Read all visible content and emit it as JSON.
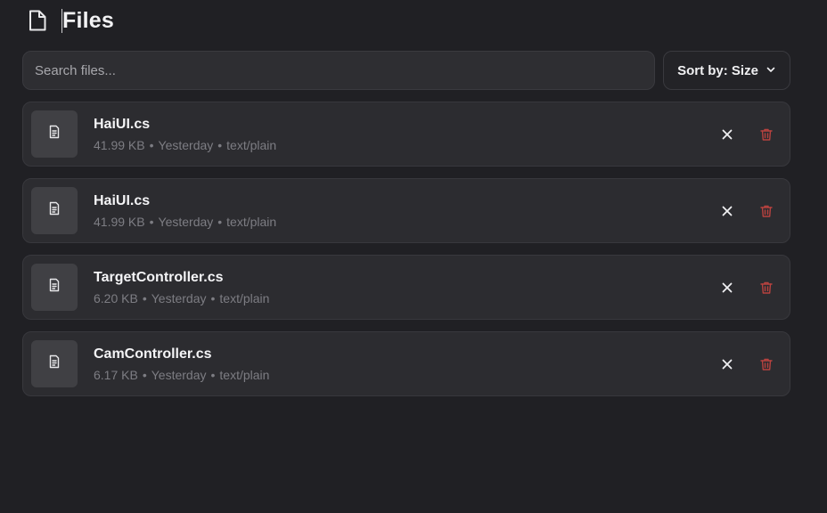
{
  "header": {
    "title": "Files",
    "icon": "file-icon"
  },
  "toolbar": {
    "search_placeholder": "Search files...",
    "search_value": "",
    "sort_label": "Sort by: Size"
  },
  "files": [
    {
      "name": "HaiUI.cs",
      "size": "41.99 KB",
      "date": "Yesterday",
      "type": "text/plain"
    },
    {
      "name": "HaiUI.cs",
      "size": "41.99 KB",
      "date": "Yesterday",
      "type": "text/plain"
    },
    {
      "name": "TargetController.cs",
      "size": "6.20 KB",
      "date": "Yesterday",
      "type": "text/plain"
    },
    {
      "name": "CamController.cs",
      "size": "6.17 KB",
      "date": "Yesterday",
      "type": "text/plain"
    }
  ],
  "meta_separator": "•",
  "colors": {
    "background": "#202024",
    "row_background": "#2c2c30",
    "delete_accent": "#b8423f"
  }
}
